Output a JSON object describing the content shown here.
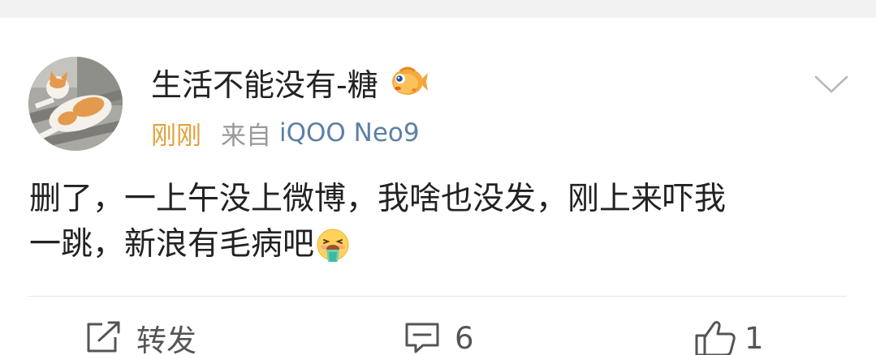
{
  "post": {
    "username": "生活不能没有-糖",
    "badge_icon": "fish-badge-icon",
    "meta": {
      "time": "刚刚",
      "source_prefix": "来自",
      "device": "iQOO Neo9"
    },
    "content": {
      "line1": "删了，一上午没上微博，我啥也没发，刚上来吓我",
      "line2": "一跳，新浪有毛病吧",
      "emoji": "vomit-face-emoji"
    },
    "actions": {
      "repost_label": "转发",
      "comment_count": "6",
      "like_count": "1"
    }
  }
}
